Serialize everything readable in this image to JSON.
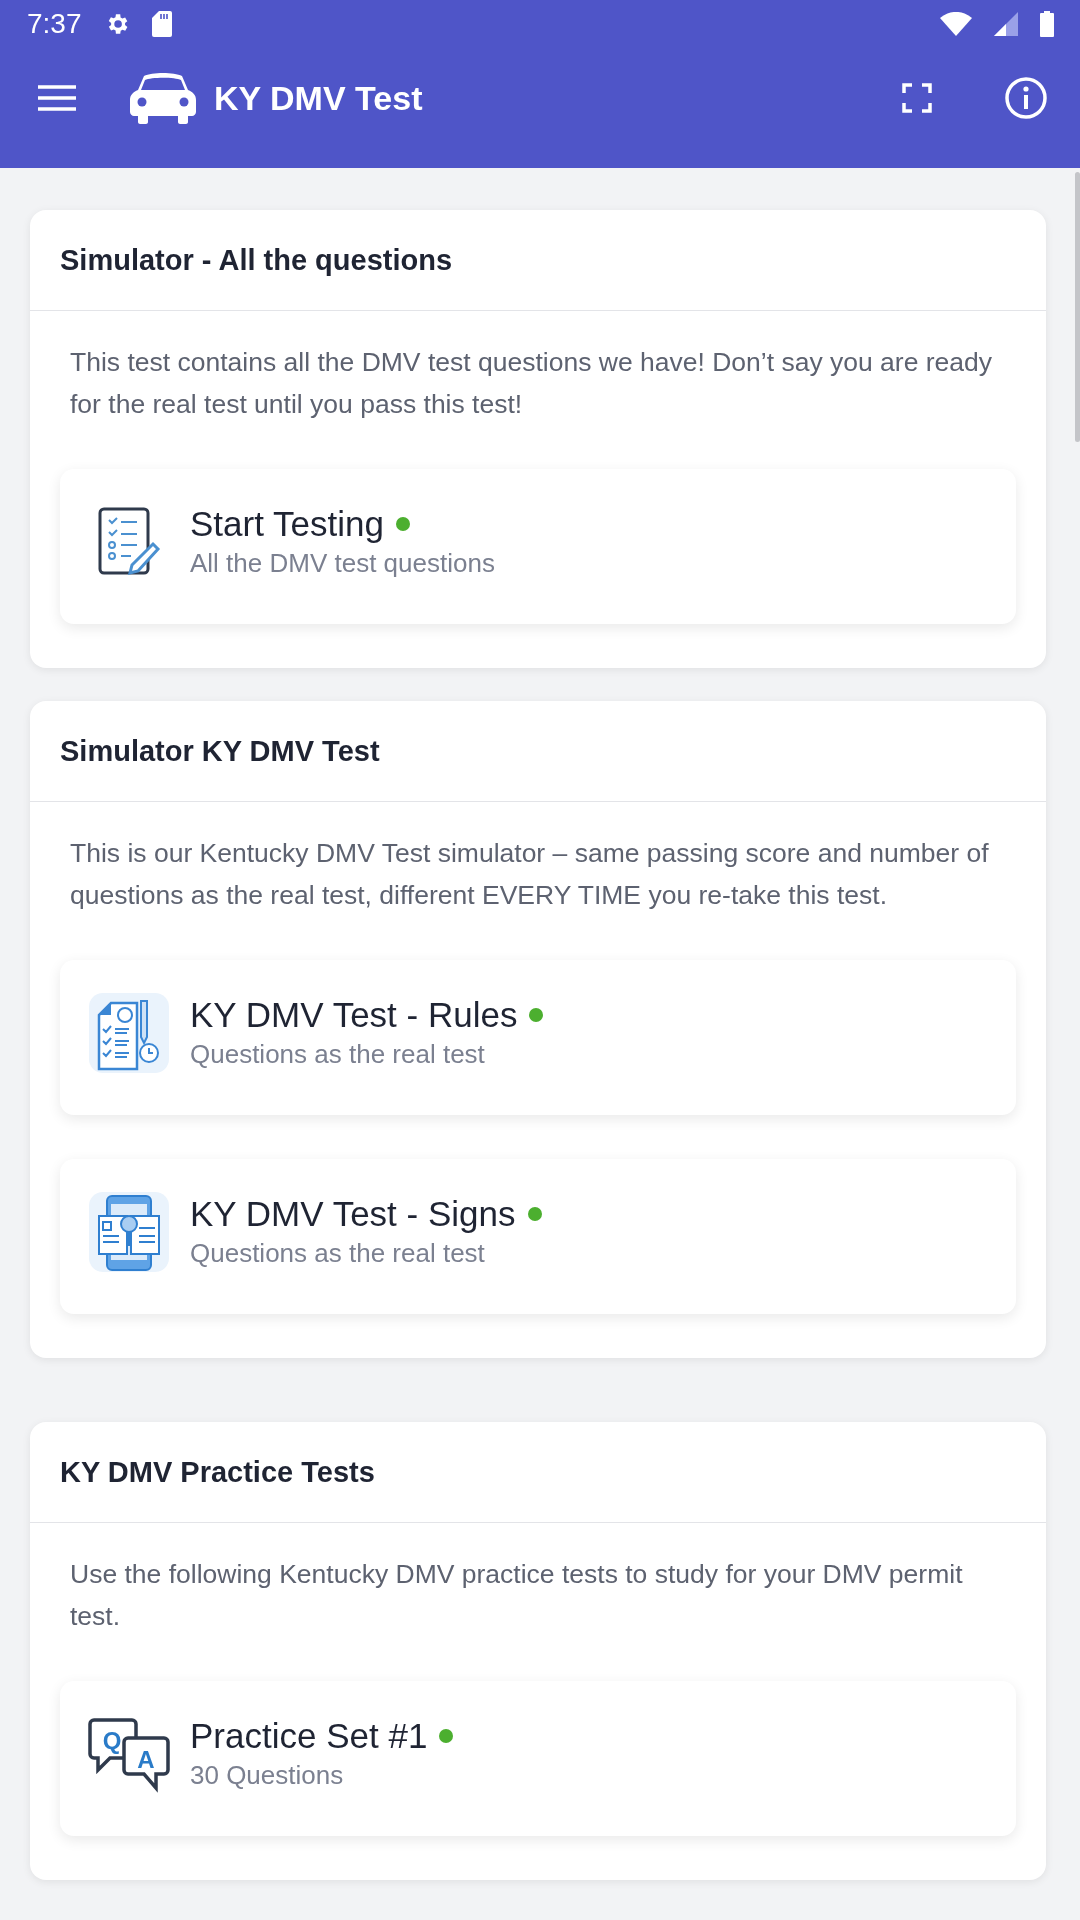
{
  "status_bar": {
    "time": "7:37"
  },
  "app_bar": {
    "title": "KY DMV Test"
  },
  "sections": [
    {
      "title": "Simulator - All the questions",
      "description": "This test contains all the DMV test questions we have! Don’t say you are ready for the real test until you pass this test!",
      "items": [
        {
          "kind": "checklist",
          "title": "Start Testing",
          "subtitle": "All the DMV test questions",
          "available": true
        }
      ]
    },
    {
      "title": "Simulator KY DMV Test",
      "description": "This is our Kentucky DMV Test simulator – same passing score and number of questions as the real test, different EVERY TIME you re-take this test.",
      "items": [
        {
          "kind": "rules",
          "title": "KY DMV Test - Rules",
          "subtitle": "Questions as the real test",
          "available": true
        },
        {
          "kind": "signs",
          "title": "KY DMV Test - Signs",
          "subtitle": "Questions as the real test",
          "available": true
        }
      ]
    },
    {
      "title": "KY DMV Practice Tests",
      "description": "Use the following Kentucky DMV practice tests to study for your DMV permit test.",
      "items": [
        {
          "kind": "qa",
          "icon_letters": [
            "Q",
            "A"
          ],
          "title": "Practice Set #1",
          "subtitle": "30 Questions",
          "available": true
        }
      ]
    }
  ]
}
